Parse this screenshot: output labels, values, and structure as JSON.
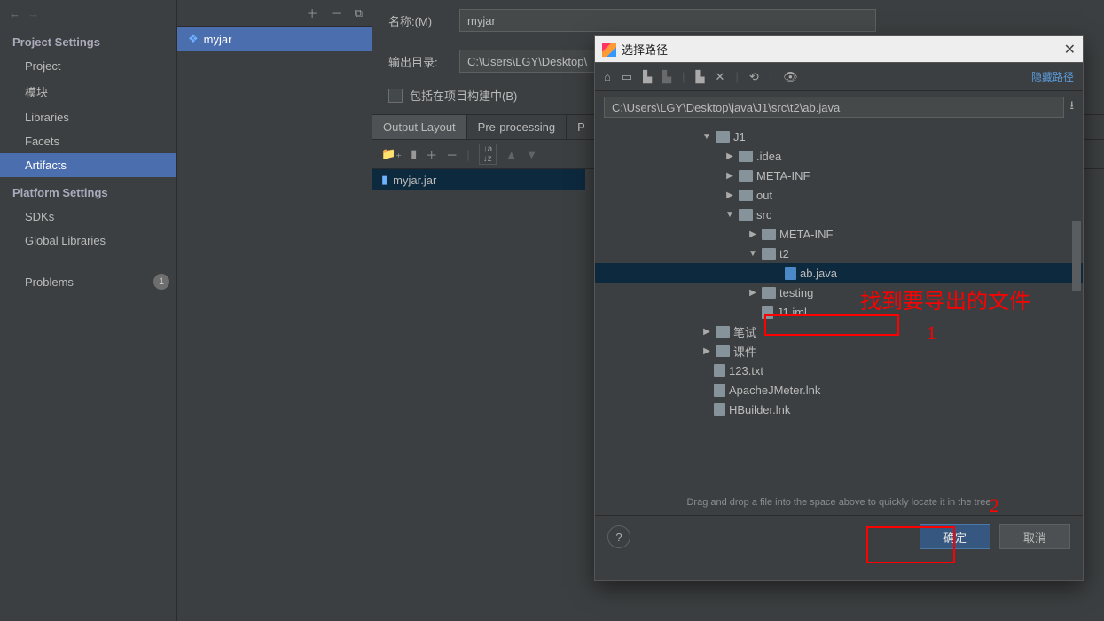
{
  "sidebar": {
    "section1": "Project Settings",
    "items1": [
      "Project",
      "模块",
      "Libraries",
      "Facets",
      "Artifacts"
    ],
    "section2": "Platform Settings",
    "items2": [
      "SDKs",
      "Global Libraries"
    ],
    "problems": "Problems",
    "problems_count": "1"
  },
  "mid": {
    "item": "myjar"
  },
  "form": {
    "name_label": "名称:(M)",
    "name_value": "myjar",
    "output_label": "输出目录:",
    "output_value": "C:\\Users\\LGY\\Desktop\\",
    "include_label": "包括在项目构建中(B)"
  },
  "tabs": {
    "t1": "Output Layout",
    "t2": "Pre-processing",
    "t3": "P"
  },
  "layout": {
    "entry": "myjar.jar"
  },
  "dialog": {
    "title": "选择路径",
    "hide_path": "隐藏路径",
    "path": "C:\\Users\\LGY\\Desktop\\java\\J1\\src\\t2\\ab.java",
    "hint": "Drag and drop a file into the space above to quickly locate it in the tree",
    "ok": "确定",
    "cancel": "取消",
    "tree": {
      "j1": "J1",
      "idea": ".idea",
      "metainf": "META-INF",
      "out": "out",
      "src": "src",
      "metainf2": "META-INF",
      "t2": "t2",
      "abjava": "ab.java",
      "testing": "testing",
      "j1iml": "J1.iml",
      "bishi": "笔试",
      "kejian": "课件",
      "txt": "123.txt",
      "jmeter": "ApacheJMeter.lnk",
      "hbuilder": "HBuilder.lnk"
    }
  },
  "annotations": {
    "t1": "找到要导出的文件",
    "n1": "1",
    "n2": "2"
  }
}
